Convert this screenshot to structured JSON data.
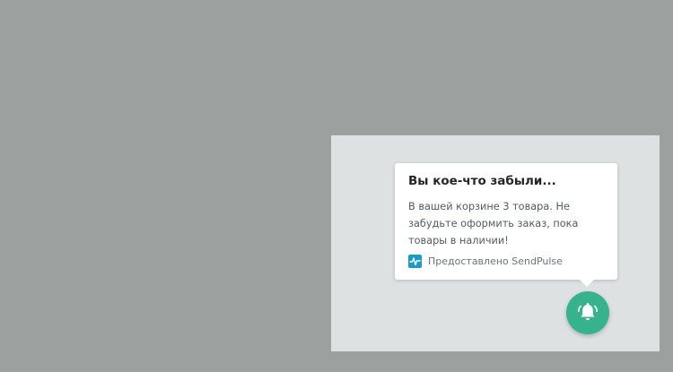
{
  "notification": {
    "title": "Вы кое-что забыли...",
    "body": "В вашей корзине 3 товара. Не забудьте оформить заказ, пока товары в наличии!",
    "footer_text": "Предоставлено SendPulse",
    "brand_icon": "sendpulse-logo-icon"
  },
  "bell_button": {
    "icon": "bell-ringing-icon",
    "color": "#36b28d"
  },
  "colors": {
    "page_background": "#9ca09f",
    "panel_background": "#dee1e2",
    "card_background": "#ffffff",
    "brand_blue": "#1a9bc4"
  }
}
